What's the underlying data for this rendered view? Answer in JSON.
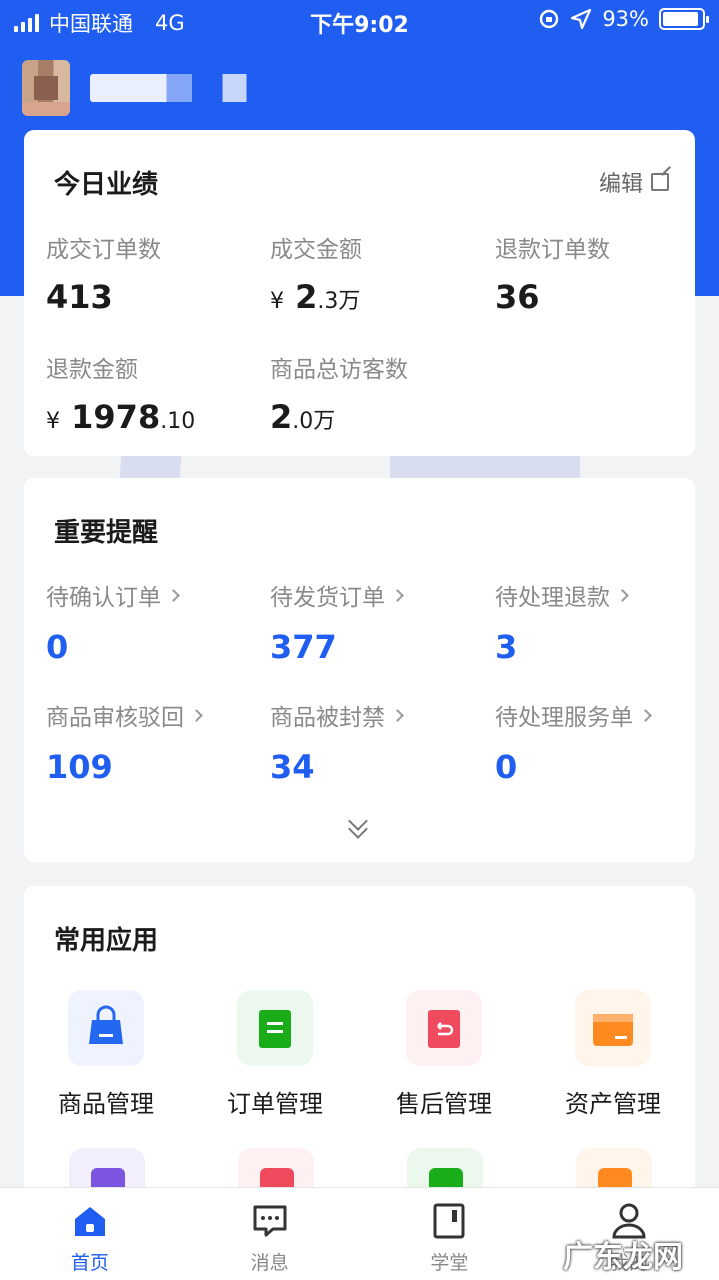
{
  "status_bar": {
    "carrier": "中国联通",
    "network": "4G",
    "time": "下午9:02",
    "battery": "93%",
    "battery_level": 0.93
  },
  "profile": {
    "username": "▇▇▇▇ ▄ ▙"
  },
  "performance": {
    "title": "今日业绩",
    "edit_label": "编辑",
    "stats": [
      {
        "label": "成交订单数",
        "value": "413"
      },
      {
        "label": "成交金额",
        "symbol": "¥",
        "value": "2",
        "suffix": ".3万"
      },
      {
        "label": "退款订单数",
        "value": "36"
      },
      {
        "label": "退款金额",
        "symbol": "¥",
        "value": "1978",
        "suffix": ".10"
      },
      {
        "label": "商品总访客数",
        "value": "2",
        "suffix": ".0万"
      }
    ]
  },
  "reminders": {
    "title": "重要提醒",
    "items": [
      {
        "label": "待确认订单",
        "value": "0"
      },
      {
        "label": "待发货订单",
        "value": "377"
      },
      {
        "label": "待处理退款",
        "value": "3"
      },
      {
        "label": "商品审核驳回",
        "value": "109"
      },
      {
        "label": "商品被封禁",
        "value": "34"
      },
      {
        "label": "待处理服务单",
        "value": "0"
      }
    ]
  },
  "apps": {
    "title": "常用应用",
    "items": [
      {
        "label": "商品管理",
        "icon": "shopping-bag-icon",
        "color": "#2468f2",
        "bg": "#eef3ff"
      },
      {
        "label": "订单管理",
        "icon": "order-clipboard-icon",
        "color": "#1aad19",
        "bg": "#ecf8ee"
      },
      {
        "label": "售后管理",
        "icon": "after-sale-return-icon",
        "color": "#f04a5e",
        "bg": "#fff0f1"
      },
      {
        "label": "资产管理",
        "icon": "wallet-icon",
        "color": "#ff8a1f",
        "bg": "#fff5ea"
      }
    ],
    "partial_row_colors": [
      "#7b55e0",
      "#f04a5e",
      "#1aad19",
      "#ff8a1f"
    ]
  },
  "bottom_nav": [
    {
      "label": "首页",
      "icon": "home-icon",
      "active": true
    },
    {
      "label": "消息",
      "icon": "message-icon",
      "active": false
    },
    {
      "label": "学堂",
      "icon": "book-icon",
      "active": false
    },
    {
      "label": "我的",
      "icon": "profile-icon",
      "active": false
    }
  ],
  "brand_watermark": "广东龙网",
  "colors": {
    "primary": "#1f5ef0",
    "background": "#f2f3f5"
  }
}
